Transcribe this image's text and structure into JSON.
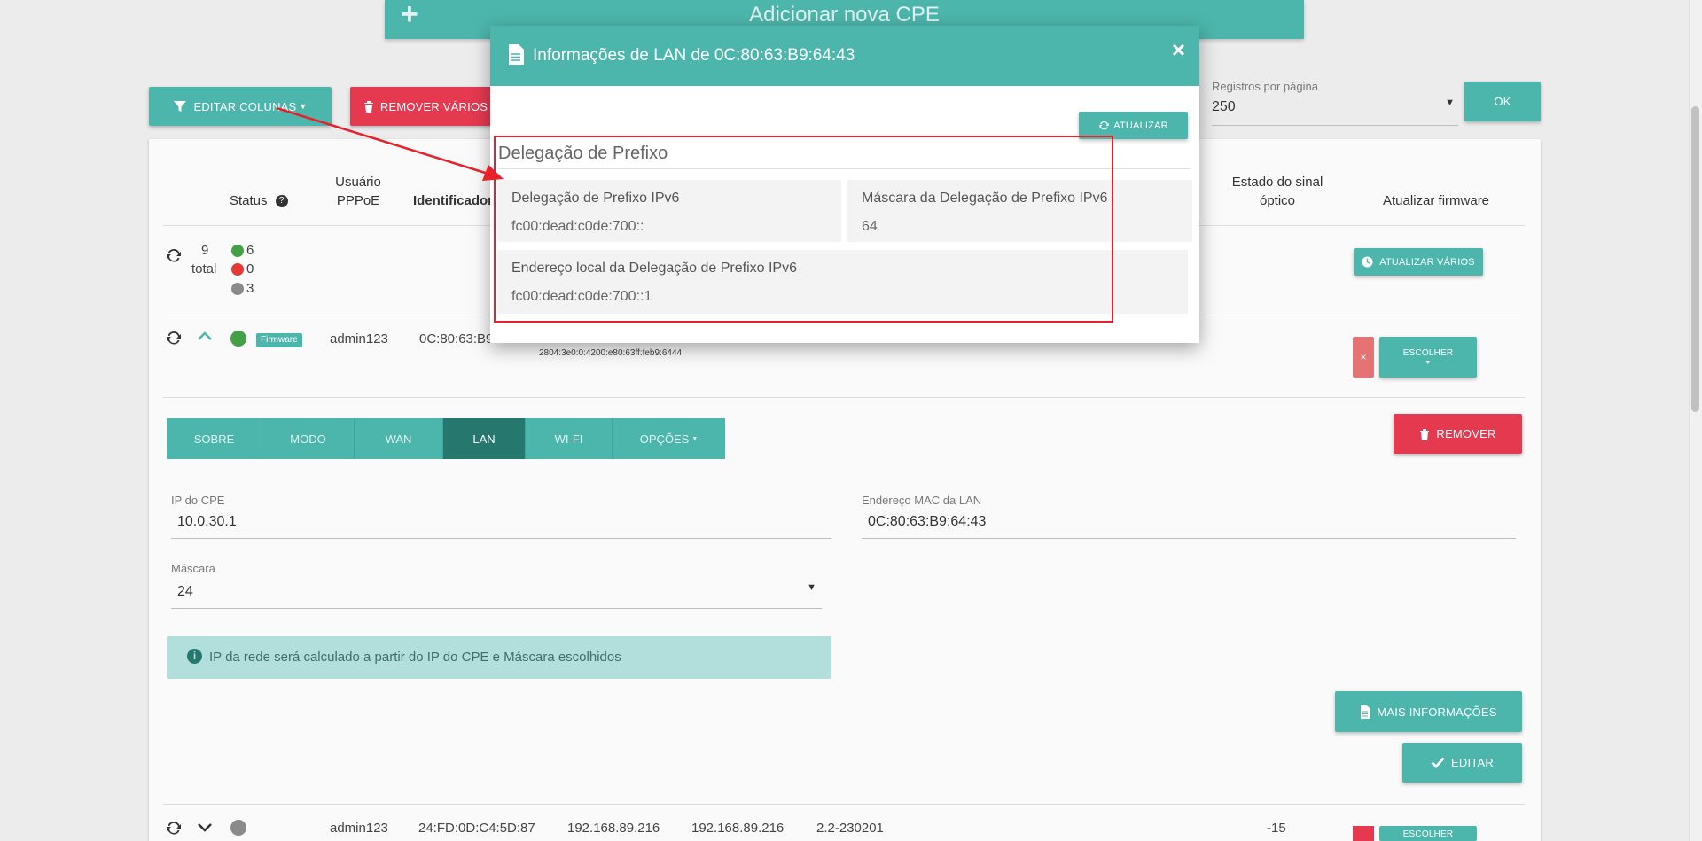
{
  "add_bar": {
    "label": "Adicionar nova CPE"
  },
  "toolbar": {
    "edit_columns": "EDITAR COLUNAS",
    "remove_multiple": "REMOVER VÁRIOS",
    "records_label": "Registros por página",
    "records_value": "250",
    "ok": "OK"
  },
  "table": {
    "headers": {
      "status": "Status",
      "pppoe_user_1": "Usuário",
      "pppoe_user_2": "PPPoE",
      "identifier": "Identificador",
      "signal_1": "Estado do sinal",
      "signal_2": "óptico",
      "update_firmware": "Atualizar firmware"
    },
    "summary": {
      "total_count": "9",
      "total_label": "total",
      "green_count": "6",
      "red_count": "0",
      "grey_count": "3",
      "update_many": "ATUALIZAR VÁRIOS"
    },
    "row1": {
      "badge": "Firmware",
      "user": "admin123",
      "identifier": "0C:80:63:B9:64:43",
      "ipv6": "2804:3e0:0:4200:e80:63ff:feb9:6444",
      "choose": "ESCOLHER"
    },
    "row2": {
      "user": "admin123",
      "identifier": "24:FD:0D:C4:5D:87",
      "ip1": "192.168.89.216",
      "ip2": "192.168.89.216",
      "version": "2.2-230201",
      "signal": "-15",
      "choose": "ESCOLHER"
    }
  },
  "tabs": [
    "SOBRE",
    "MODO",
    "WAN",
    "LAN",
    "WI-FI",
    "OPÇÕES"
  ],
  "lan_form": {
    "cpe_ip_label": "IP do CPE",
    "cpe_ip_value": "10.0.30.1",
    "mac_label": "Endereço MAC da LAN",
    "mac_value": "0C:80:63:B9:64:43",
    "mask_label": "Máscara",
    "mask_value": "24",
    "info_text": "IP da rede será calculado a partir do IP do CPE e Máscara escolhidos",
    "remove": "REMOVER",
    "more_info": "MAIS INFORMAÇÕES",
    "edit": "EDITAR"
  },
  "modal": {
    "title": "Informações de LAN de 0C:80:63:B9:64:43",
    "close": "×",
    "refresh": "ATUALIZAR",
    "section_title": "Delegação de Prefixo",
    "prefix_label": "Delegação de Prefixo IPv6",
    "prefix_value": "fc00:dead:c0de:700::",
    "mask_label": "Máscara da Delegação de Prefixo IPv6",
    "mask_value": "64",
    "local_label": "Endereço local da Delegação de Prefixo IPv6",
    "local_value": "fc00:dead:c0de:700::1"
  },
  "colors": {
    "teal": "#4db6ac",
    "dark_teal": "#26786f",
    "red": "#e53950",
    "annotation_red": "#e8202a"
  }
}
